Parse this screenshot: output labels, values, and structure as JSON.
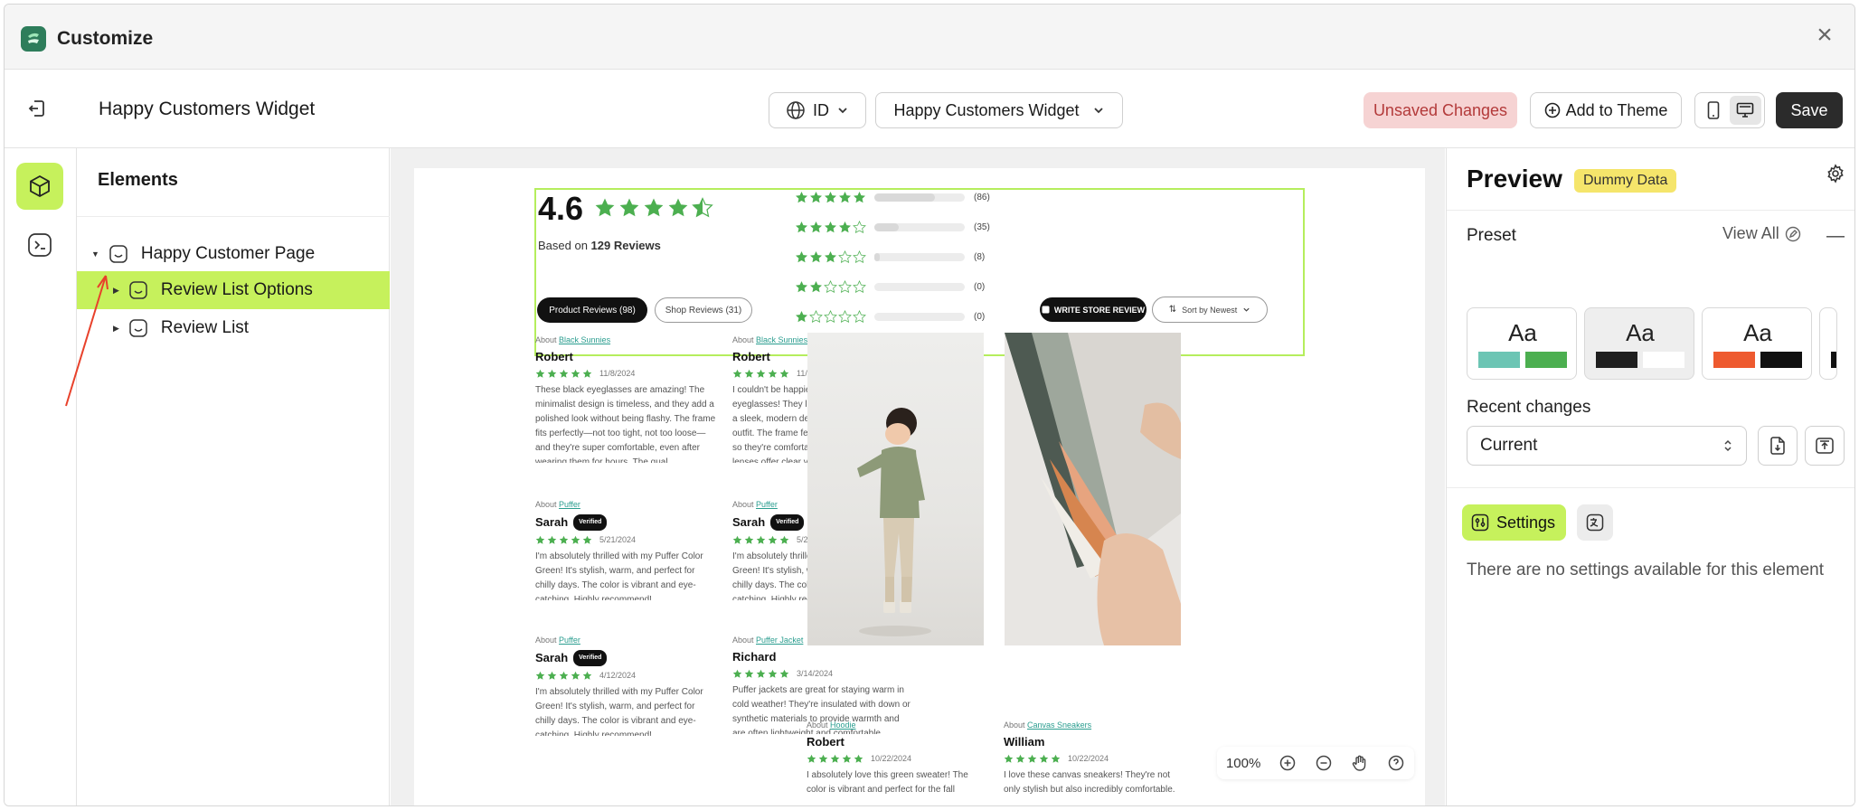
{
  "window": {
    "title": "Customize",
    "close": "×"
  },
  "toolbar": {
    "page_name": "Happy Customers Widget",
    "locale": "ID",
    "widget_select": "Happy Customers Widget",
    "unsaved": "Unsaved Changes",
    "add_to_theme": "Add to Theme",
    "save": "Save"
  },
  "elements": {
    "title": "Elements",
    "tree": [
      {
        "label": "Happy Customer Page"
      },
      {
        "label": "Review List Options"
      },
      {
        "label": "Review List"
      }
    ]
  },
  "widget": {
    "rating": "4.6",
    "based_on_prefix": "Based on ",
    "based_on_count": "129 Reviews",
    "distribution": [
      {
        "stars": 5,
        "count": "(86)",
        "fill": 0.67
      },
      {
        "stars": 4,
        "count": "(35)",
        "fill": 0.27
      },
      {
        "stars": 3,
        "count": "(8)",
        "fill": 0.06
      },
      {
        "stars": 2,
        "count": "(0)",
        "fill": 0
      },
      {
        "stars": 1,
        "count": "(0)",
        "fill": 0
      }
    ],
    "tab_product": "Product Reviews (98)",
    "tab_shop": "Shop Reviews (31)",
    "write_review": "WRITE STORE REVIEW",
    "sort": "Sort by Newest",
    "reviews": [
      {
        "about_label": "About ",
        "about": "Black Sunnies",
        "name": "Robert",
        "verified": "",
        "date": "11/8/2024",
        "text": "These black eyeglasses are amazing! The minimalist design is timeless, and they add a polished look without being flashy. The frame fits perfectly—not too tight, not too loose—and they're super comfortable, even after wearing them for hours. The qual..."
      },
      {
        "about_label": "About ",
        "about": "Black Sunnies",
        "name": "Robert",
        "verified": "",
        "date": "11/8/2024",
        "text": "I couldn't be happier with my new black eyeglasses! They look incredibly stylish, with a sleek, modern design that goes with any outfit. The frame feels sturdy but lightweight, so they're comfortable to wear all day. The lenses offer clear vision wit..."
      },
      {
        "about_label": "About ",
        "about": "Puffer",
        "name": "Sarah",
        "verified": "Verified",
        "date": "5/21/2024",
        "text": "I'm absolutely thrilled with my Puffer Color Green! It's stylish, warm, and perfect for chilly days. The color is vibrant and eye-catching. Highly recommend!"
      },
      {
        "about_label": "About ",
        "about": "Puffer",
        "name": "Sarah",
        "verified": "Verified",
        "date": "5/21/2024",
        "text": "I'm absolutely thrilled with my Puffer Color Green! It's stylish, warm, and perfect for chilly days. The color is vibrant and eye-catching. Highly recommend!"
      },
      {
        "about_label": "About ",
        "about": "Puffer",
        "name": "Sarah",
        "verified": "Verified",
        "date": "4/12/2024",
        "text": "I'm absolutely thrilled with my Puffer Color Green! It's stylish, warm, and perfect for chilly days. The color is vibrant and eye-catching. Highly recommend!"
      },
      {
        "about_label": "About ",
        "about": "Puffer Jacket",
        "name": "Richard",
        "verified": "",
        "date": "3/14/2024",
        "text": "Puffer jackets are great for staying warm in cold weather! They're insulated with down or synthetic materials to provide warmth and are often lightweight and comfortable"
      },
      {
        "about_label": "About ",
        "about": "Hoodie",
        "name": "Robert",
        "verified": "",
        "date": "10/22/2024",
        "text": "I absolutely love this green sweater! The color is vibrant and perfect for the fall"
      },
      {
        "about_label": "About ",
        "about": "Canvas Sneakers",
        "name": "William",
        "verified": "",
        "date": "10/22/2024",
        "text": "I love these canvas sneakers! They're not only stylish but also incredibly comfortable."
      }
    ]
  },
  "zoom": {
    "level": "100%"
  },
  "preview": {
    "title": "Preview",
    "badge": "Dummy Data",
    "preset_label": "Preset",
    "view_all": "View All",
    "preset_sample": "Aa",
    "presets": [
      {
        "colors": [
          "#6cc5b4",
          "#4caf50"
        ]
      },
      {
        "colors": [
          "#1f1f1f",
          "#ffffff"
        ]
      },
      {
        "colors": [
          "#ee5a2f",
          "#111111"
        ]
      },
      {
        "colors": [
          "#111111",
          "#ffffff"
        ]
      }
    ],
    "recent_label": "Recent changes",
    "recent_value": "Current",
    "settings_tab": "Settings",
    "empty_msg": "There are no settings available for this element"
  },
  "colors": {
    "accent": "#c6f15c",
    "unsaved_bg": "#f6d3d3",
    "unsaved_fg": "#b33a3a",
    "badge_bg": "#f5e56b",
    "star": "#4caf50",
    "widget_outline": "#b5ee5d",
    "annotation": "#e8412b"
  }
}
